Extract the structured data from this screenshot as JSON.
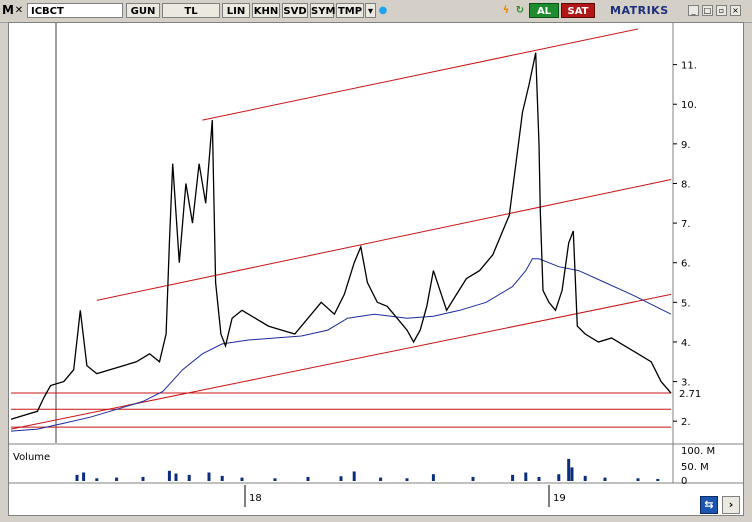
{
  "toolbar": {
    "menu_letter": "M",
    "symbol": "ICBCT",
    "buttons": [
      "GUN",
      "TL",
      "LIN",
      "KHN",
      "SVD",
      "SYM",
      "TMP"
    ],
    "al_label": "AL",
    "sat_label": "SAT",
    "brand": "MATRIKS",
    "colors": {
      "al": "#1f8b2f",
      "sat": "#b01818",
      "brand": "#1c2f7a"
    }
  },
  "chart_data": {
    "type": "line",
    "price_axis": {
      "min": 1.5,
      "max": 12.0,
      "ticks": [
        2,
        3,
        4,
        5,
        6,
        7,
        8,
        9,
        10,
        11
      ],
      "last_price_label": "2.71"
    },
    "volume_axis": {
      "ticks": [
        "100. M",
        "50. M",
        "0"
      ],
      "max_millions": 100
    },
    "volume_label": "Volume",
    "x_tick_labels": [
      "18",
      "19"
    ],
    "price_path": [
      [
        0.0,
        2.05
      ],
      [
        0.02,
        2.15
      ],
      [
        0.04,
        2.25
      ],
      [
        0.05,
        2.6
      ],
      [
        0.06,
        2.9
      ],
      [
        0.08,
        3.0
      ],
      [
        0.095,
        3.3
      ],
      [
        0.105,
        4.8
      ],
      [
        0.115,
        3.4
      ],
      [
        0.13,
        3.2
      ],
      [
        0.16,
        3.35
      ],
      [
        0.19,
        3.5
      ],
      [
        0.21,
        3.7
      ],
      [
        0.225,
        3.5
      ],
      [
        0.235,
        4.2
      ],
      [
        0.24,
        6.5
      ],
      [
        0.245,
        8.5
      ],
      [
        0.255,
        6.0
      ],
      [
        0.265,
        8.0
      ],
      [
        0.275,
        7.0
      ],
      [
        0.285,
        8.5
      ],
      [
        0.295,
        7.5
      ],
      [
        0.305,
        9.6
      ],
      [
        0.31,
        5.5
      ],
      [
        0.318,
        4.2
      ],
      [
        0.325,
        3.9
      ],
      [
        0.335,
        4.6
      ],
      [
        0.35,
        4.8
      ],
      [
        0.37,
        4.6
      ],
      [
        0.39,
        4.4
      ],
      [
        0.41,
        4.3
      ],
      [
        0.43,
        4.2
      ],
      [
        0.45,
        4.6
      ],
      [
        0.47,
        5.0
      ],
      [
        0.49,
        4.7
      ],
      [
        0.505,
        5.2
      ],
      [
        0.52,
        6.0
      ],
      [
        0.53,
        6.4
      ],
      [
        0.54,
        5.5
      ],
      [
        0.555,
        5.0
      ],
      [
        0.57,
        4.9
      ],
      [
        0.585,
        4.6
      ],
      [
        0.6,
        4.3
      ],
      [
        0.61,
        4.0
      ],
      [
        0.62,
        4.3
      ],
      [
        0.63,
        4.9
      ],
      [
        0.64,
        5.8
      ],
      [
        0.65,
        5.3
      ],
      [
        0.66,
        4.8
      ],
      [
        0.675,
        5.2
      ],
      [
        0.69,
        5.6
      ],
      [
        0.71,
        5.8
      ],
      [
        0.73,
        6.2
      ],
      [
        0.745,
        6.8
      ],
      [
        0.755,
        7.2
      ],
      [
        0.765,
        8.5
      ],
      [
        0.775,
        9.8
      ],
      [
        0.785,
        10.5
      ],
      [
        0.795,
        11.3
      ],
      [
        0.8,
        9.0
      ],
      [
        0.802,
        7.3
      ],
      [
        0.806,
        5.3
      ],
      [
        0.815,
        5.0
      ],
      [
        0.825,
        4.8
      ],
      [
        0.835,
        5.3
      ],
      [
        0.845,
        6.5
      ],
      [
        0.852,
        6.8
      ],
      [
        0.858,
        4.4
      ],
      [
        0.87,
        4.2
      ],
      [
        0.89,
        4.0
      ],
      [
        0.91,
        4.1
      ],
      [
        0.93,
        3.9
      ],
      [
        0.95,
        3.7
      ],
      [
        0.97,
        3.5
      ],
      [
        0.985,
        3.0
      ],
      [
        1.0,
        2.71
      ]
    ],
    "ma_path": [
      [
        0.0,
        1.75
      ],
      [
        0.04,
        1.8
      ],
      [
        0.08,
        1.95
      ],
      [
        0.12,
        2.1
      ],
      [
        0.16,
        2.3
      ],
      [
        0.2,
        2.5
      ],
      [
        0.23,
        2.75
      ],
      [
        0.26,
        3.3
      ],
      [
        0.29,
        3.7
      ],
      [
        0.32,
        3.95
      ],
      [
        0.36,
        4.05
      ],
      [
        0.4,
        4.1
      ],
      [
        0.44,
        4.15
      ],
      [
        0.48,
        4.3
      ],
      [
        0.51,
        4.6
      ],
      [
        0.55,
        4.7
      ],
      [
        0.6,
        4.6
      ],
      [
        0.64,
        4.65
      ],
      [
        0.68,
        4.8
      ],
      [
        0.72,
        5.0
      ],
      [
        0.76,
        5.4
      ],
      [
        0.78,
        5.8
      ],
      [
        0.79,
        6.1
      ],
      [
        0.8,
        6.1
      ],
      [
        0.83,
        5.9
      ],
      [
        0.86,
        5.8
      ],
      [
        0.9,
        5.5
      ],
      [
        0.94,
        5.2
      ],
      [
        0.97,
        4.95
      ],
      [
        1.0,
        4.7
      ]
    ],
    "channel_lines": [
      {
        "from": [
          0.29,
          9.6
        ],
        "to": [
          0.95,
          11.9
        ]
      },
      {
        "from": [
          0.13,
          5.05
        ],
        "to": [
          1.0,
          8.1
        ]
      },
      {
        "from": [
          0.0,
          1.8
        ],
        "to": [
          1.0,
          5.2
        ]
      }
    ],
    "horizontal_lines": [
      2.71,
      2.3,
      1.85
    ],
    "volume_bars": [
      [
        0.1,
        18
      ],
      [
        0.11,
        25
      ],
      [
        0.13,
        8
      ],
      [
        0.16,
        10
      ],
      [
        0.2,
        12
      ],
      [
        0.24,
        30
      ],
      [
        0.25,
        22
      ],
      [
        0.27,
        18
      ],
      [
        0.3,
        25
      ],
      [
        0.32,
        15
      ],
      [
        0.35,
        10
      ],
      [
        0.4,
        8
      ],
      [
        0.45,
        12
      ],
      [
        0.5,
        14
      ],
      [
        0.52,
        28
      ],
      [
        0.56,
        10
      ],
      [
        0.6,
        8
      ],
      [
        0.64,
        20
      ],
      [
        0.7,
        12
      ],
      [
        0.76,
        18
      ],
      [
        0.78,
        25
      ],
      [
        0.8,
        12
      ],
      [
        0.83,
        20
      ],
      [
        0.845,
        65
      ],
      [
        0.85,
        40
      ],
      [
        0.87,
        15
      ],
      [
        0.9,
        10
      ],
      [
        0.95,
        8
      ],
      [
        0.98,
        6
      ]
    ],
    "grid": false,
    "colors": {
      "price": "#000000",
      "ma": "#1c2a9a",
      "channel": "#c81414",
      "volume": "#0c2e7a"
    }
  }
}
